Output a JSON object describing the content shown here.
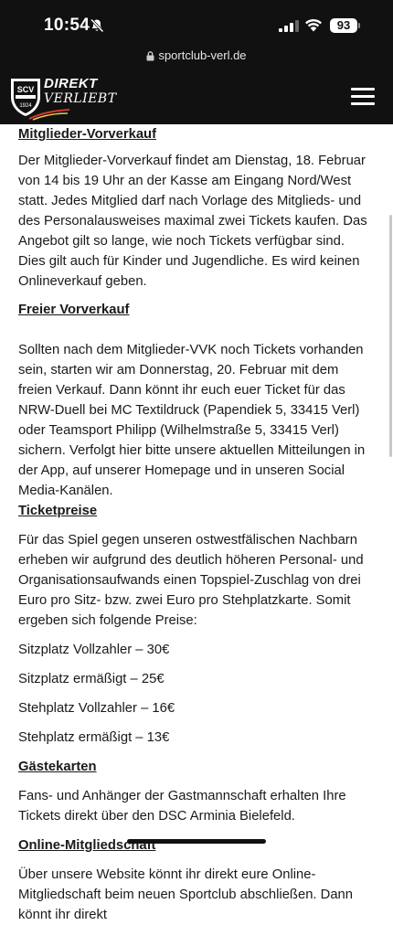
{
  "status": {
    "time": "10:54",
    "battery": "93"
  },
  "browser": {
    "url": "sportclub-verl.de"
  },
  "header": {
    "logo_badge": "SCV",
    "logo_year": "1924",
    "logo_line1": "DIREKT",
    "logo_line2": "VERLIEBT"
  },
  "article": {
    "s1_title": "Mitglieder-Vorverkauf",
    "s1_text": "Der Mitglieder-Vorverkauf findet am Dienstag, 18. Februar von 14 bis 19 Uhr an der Kasse am Eingang Nord/West statt. Jedes Mitglied darf nach Vorlage des Mitglieds- und des Personalausweises maximal zwei Tickets kaufen. Das Angebot gilt so lange, wie noch Tickets verfügbar sind. Dies gilt auch für Kinder und Jugendliche. Es wird keinen Onlineverkauf geben.",
    "s2_title": "Freier Vorverkauf",
    "s2_text": "Sollten nach dem Mitglieder-VVK noch Tickets vorhanden sein, starten wir am Donnerstag, 20. Februar mit dem freien Verkauf. Dann könnt ihr euch euer Ticket für das NRW-Duell bei MC Textildruck (Papendiek 5, 33415 Verl) oder Teamsport Philipp (Wilhelmstraße 5, 33415 Verl) sichern. Verfolgt hier bitte unsere aktuellen Mitteilungen in der App, auf unserer Homepage und in unseren Social Media-Kanälen.",
    "s3_title": "Ticketpreise",
    "s3_text": "Für das Spiel gegen unseren ostwestfälischen Nachbarn erheben wir aufgrund des deutlich höheren Personal- und Organisationsaufwands einen Topspiel-Zuschlag von drei Euro pro Sitz- bzw. zwei Euro pro Stehplatzkarte. Somit ergeben sich folgende Preise:",
    "prices": [
      "Sitzplatz Vollzahler – 30€",
      "Sitzplatz ermäßigt – 25€",
      "Stehplatz Vollzahler – 16€",
      "Stehplatz ermäßigt – 13€"
    ],
    "s4_title": "Gästekarten",
    "s4_text": "Fans- und Anhänger der Gastmannschaft erhalten Ihre Tickets direkt über den DSC Arminia Bielefeld.",
    "s5_title": "Online-Mitgliedschaft",
    "s5_text": "Über unsere Website könnt ihr direkt eure Online-Mitgliedschaft beim neuen Sportclub abschließen. Dann könnt ihr direkt"
  }
}
